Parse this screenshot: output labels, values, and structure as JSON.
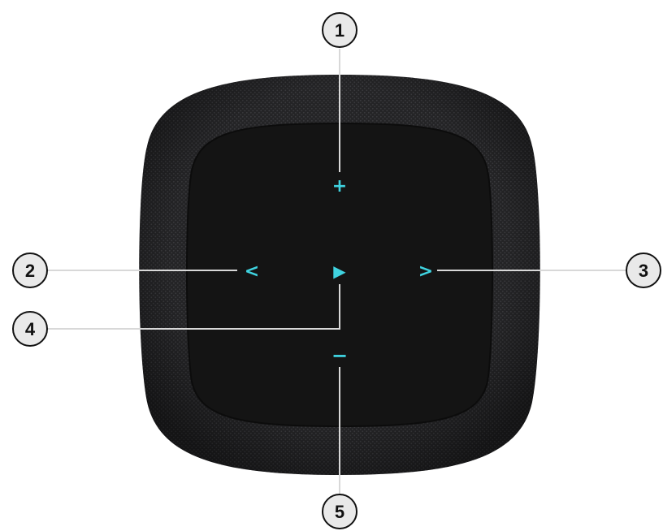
{
  "device": {
    "accent_color": "#3fd3e0",
    "mesh_color": "#2a2a2c",
    "top_surface_color": "#141414"
  },
  "controls": {
    "volume_up": {
      "glyph": "+",
      "icon": "plus-icon"
    },
    "previous": {
      "glyph": "<",
      "icon": "chevron-left-icon"
    },
    "play_pause": {
      "glyph": "▶",
      "icon": "play-icon"
    },
    "next": {
      "glyph": ">",
      "icon": "chevron-right-icon"
    },
    "volume_down": {
      "glyph": "−",
      "icon": "minus-icon"
    }
  },
  "callouts": {
    "c1": "1",
    "c2": "2",
    "c3": "3",
    "c4": "4",
    "c5": "5"
  }
}
